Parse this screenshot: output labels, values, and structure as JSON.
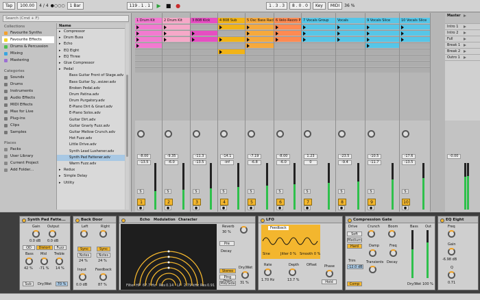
{
  "transport": {
    "tap": "Tap",
    "tempo": "100.00",
    "sig": "4 / 4",
    "metro": "●○○○",
    "rate": "1 Bar",
    "position": "119 . 1 . 1",
    "loop_start": "1 . 3 . 3",
    "loop_len": "8 . 0 . 0",
    "key": "Key",
    "midi": "MIDI",
    "cpu": "36 %"
  },
  "browser": {
    "search_placeholder": "Search (Cmd + F)",
    "collections_title": "Collections",
    "collections": [
      {
        "label": "Favourite Synths",
        "color": "#f4a12c"
      },
      {
        "label": "Favourite Effects",
        "color": "#f3d52c"
      },
      {
        "label": "Drums & Percussion",
        "color": "#4dbf4f"
      },
      {
        "label": "Mixing",
        "color": "#3aa5e0"
      },
      {
        "label": "Mastering",
        "color": "#9c6fd4"
      }
    ],
    "categories_title": "Categories",
    "categories": [
      "Sounds",
      "Drums",
      "Instruments",
      "Audio Effects",
      "MIDI Effects",
      "Max for Live",
      "Plug-ins",
      "Clips",
      "Samples"
    ],
    "places_title": "Places",
    "places": [
      "Packs",
      "User Library",
      "Current Project",
      "Add Folder..."
    ],
    "name_header": "Name",
    "items": [
      "Compressor",
      "Drum Buss",
      "Echo",
      "EQ Eight",
      "EQ Three",
      "Glue Compressor",
      "Pedal",
      "Bass Guitar Front of Stage.adv",
      "Bass Guitar Sy...esizer.adv",
      "Broken Pedal.adv",
      "Drum Patina.adv",
      "Drum Purgatory.adv",
      "E-Piano Dirt & Gnarl.adv",
      "E-Piano Solos.adv",
      "Guitar Dirt.adv",
      "Guitar Gnarly Fuzz.adv",
      "Guitar Mellow Crunch.adv",
      "Hot Fuzz.adv",
      "Little Drive.adv",
      "Synth Lead Lushener.adv",
      "Synth Pad Fattener.adv",
      "Warm Fuzz.adv",
      "Redux",
      "Simple Delay",
      "Utility"
    ],
    "selected": "Synth Pad Fattener.adv"
  },
  "tracks": [
    {
      "name": "1 Drum Kit",
      "color": "#f27ad0",
      "vol": "-8.00",
      "send": "-13.5",
      "num": "1"
    },
    {
      "name": "2 Drum Kit",
      "color": "#f6a8c8",
      "vol": "-9.35",
      "send": "-6.0",
      "num": "2"
    },
    {
      "name": "3 808 Kick",
      "color": "#e64ec2",
      "vol": "-11.3",
      "send": "-13.5",
      "num": "3"
    },
    {
      "name": "4 808 Sub",
      "color": "#f1b317",
      "vol": "-14.1",
      "send": "-inf",
      "num": "4"
    },
    {
      "name": "5 Osc Bass Rack",
      "color": "#f6a93c",
      "vol": "-7.19",
      "send": "-6.8",
      "num": "5"
    },
    {
      "name": "6 Velo-Rezzo P",
      "color": "#ff8a52",
      "vol": "-8.00",
      "send": "-6.0",
      "num": "6"
    },
    {
      "name": "7 Vocals Group",
      "color": "#56c6e8",
      "vol": "1.23",
      "send": "0",
      "num": "7"
    },
    {
      "name": "Vocals",
      "color": "#56c6e8",
      "vol": "-23.5",
      "send": "-9.4",
      "num": "8"
    },
    {
      "name": "9 Vocals Slice",
      "color": "#56c6e8",
      "vol": "-10.5",
      "send": "-11.7",
      "num": "9"
    },
    {
      "name": "10 Vocals Slice",
      "color": "#56c6e8",
      "vol": "-17.6",
      "send": "-13.5",
      "num": "10"
    },
    {
      "name": "Master",
      "color": "#c8c8c8",
      "vol": "-0.00",
      "send": "0",
      "num": ""
    }
  ],
  "scenes": [
    "Intro 1",
    "Intro 2",
    "Full",
    "Break 1",
    "Break 2",
    "Outro 1"
  ],
  "devices": {
    "synth_pad": {
      "title": "Synth Pad Fatte...",
      "gain": "Gain",
      "output": "Output",
      "gain_val": "0.0 dB",
      "out_val": "0.0 dB",
      "od": "OD",
      "distort": "Distort",
      "fuzz": "Fuzz",
      "bass": "Bass",
      "mid": "Mid",
      "treble": "Treble",
      "bass_val": "42 %",
      "mid_val": "-71 %",
      "treble_val": "14 %",
      "sub": "Sub",
      "drywet": "Dry/Wet",
      "drywet_val": "70 %"
    },
    "back_door": {
      "title": "Back Door",
      "left": "Left",
      "right": "Right",
      "sync": "Sync",
      "notes": "Notes",
      "left_val": "24 %",
      "right_val": "24 %",
      "input": "Input",
      "feedback": "Feedback",
      "input_val": "0.0 dB",
      "fb_val": "87 %"
    },
    "echo": {
      "tab_echo": "Echo",
      "tab_mod": "Modulation",
      "tab_char": "Character",
      "reverb": "Reverb",
      "reverb_val": "30 %",
      "decay": "Decay",
      "pre": "Pre",
      "stereo": "Stereo",
      "drywet": "Dry/Wet",
      "drywet_val": "31 %",
      "pingpong": "Ping Pong",
      "midside": "Mid/Side",
      "hp": "Filter HP",
      "hp_val": "67.7 Hz",
      "res": "Res",
      "res_val": "0.14",
      "lp": "LP",
      "lp_val": "2.79 kHz",
      "res2": "Res",
      "res2_val": "0.91"
    },
    "lfo": {
      "title": "LFO",
      "feedback": "Feedback",
      "shape": "Sine",
      "jitter": "Jitter 0 %",
      "smooth": "Smooth 0 %",
      "rate": "Rate",
      "rate_val": "1.70 Hz",
      "depth": "Depth",
      "depth_val": "13.7 %",
      "offset": "Offset",
      "phase": "Phase",
      "hold": "Hold"
    },
    "comp": {
      "title": "Compression Gate",
      "drive": "Drive",
      "crunch": "Crunch",
      "boom": "Boom",
      "soft": "Soft",
      "medium": "Medium",
      "hard": "Hard",
      "damp": "Damp",
      "freq": "Freq",
      "trim": "Trim",
      "trim_val": "-12.0 dB",
      "transients": "Transients",
      "decay": "Decay",
      "comp": "Comp",
      "bass": "Bass",
      "out": "Out",
      "drywet": "Dry/Wet",
      "drywet_val": "100 %"
    },
    "eq": {
      "title": "EQ Eight",
      "freq": "Freq",
      "gain": "Gain",
      "gain_val": "-6.98 dB",
      "q": "Q",
      "q_val": "0.71"
    }
  },
  "status": {
    "text": ""
  }
}
